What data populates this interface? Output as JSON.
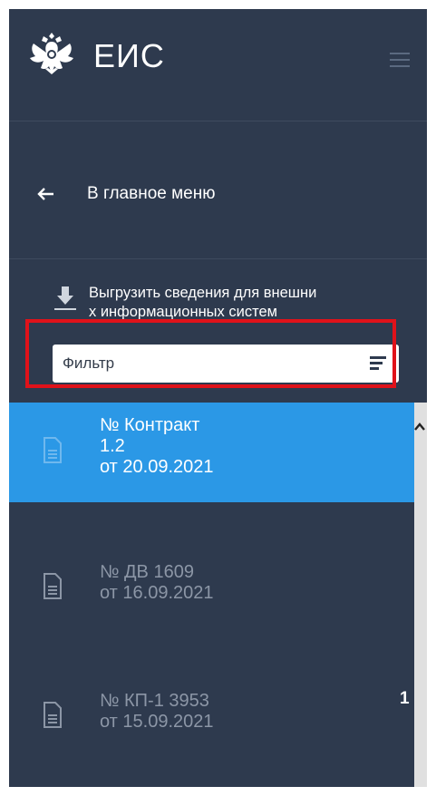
{
  "header": {
    "app_title": "ЕИС",
    "logo_icon": "russian-emblem-icon",
    "menu_icon": "hamburger-icon"
  },
  "nav": {
    "back_label": "В главное меню",
    "back_icon": "arrow-left-icon"
  },
  "export": {
    "line1": "Выгрузить сведения для внешни",
    "line2": "х информационных систем",
    "icon": "download-icon"
  },
  "filter": {
    "label": "Фильтр",
    "icon": "filter-lines-icon",
    "highlight_color": "#e0121a"
  },
  "documents": [
    {
      "lines": [
        "№ Контракт",
        "1.2",
        "от 20.09.2021"
      ],
      "active": true
    },
    {
      "lines": [
        "№ ДВ 1609",
        "от 16.09.2021"
      ],
      "active": false
    },
    {
      "lines": [
        "№ КП-1 3953",
        "от 15.09.2021"
      ],
      "active": false
    }
  ],
  "side_number": "1",
  "colors": {
    "sidebar": "#2e3a4e",
    "accent": "#2b98e6",
    "muted_text": "#8c96a6"
  }
}
